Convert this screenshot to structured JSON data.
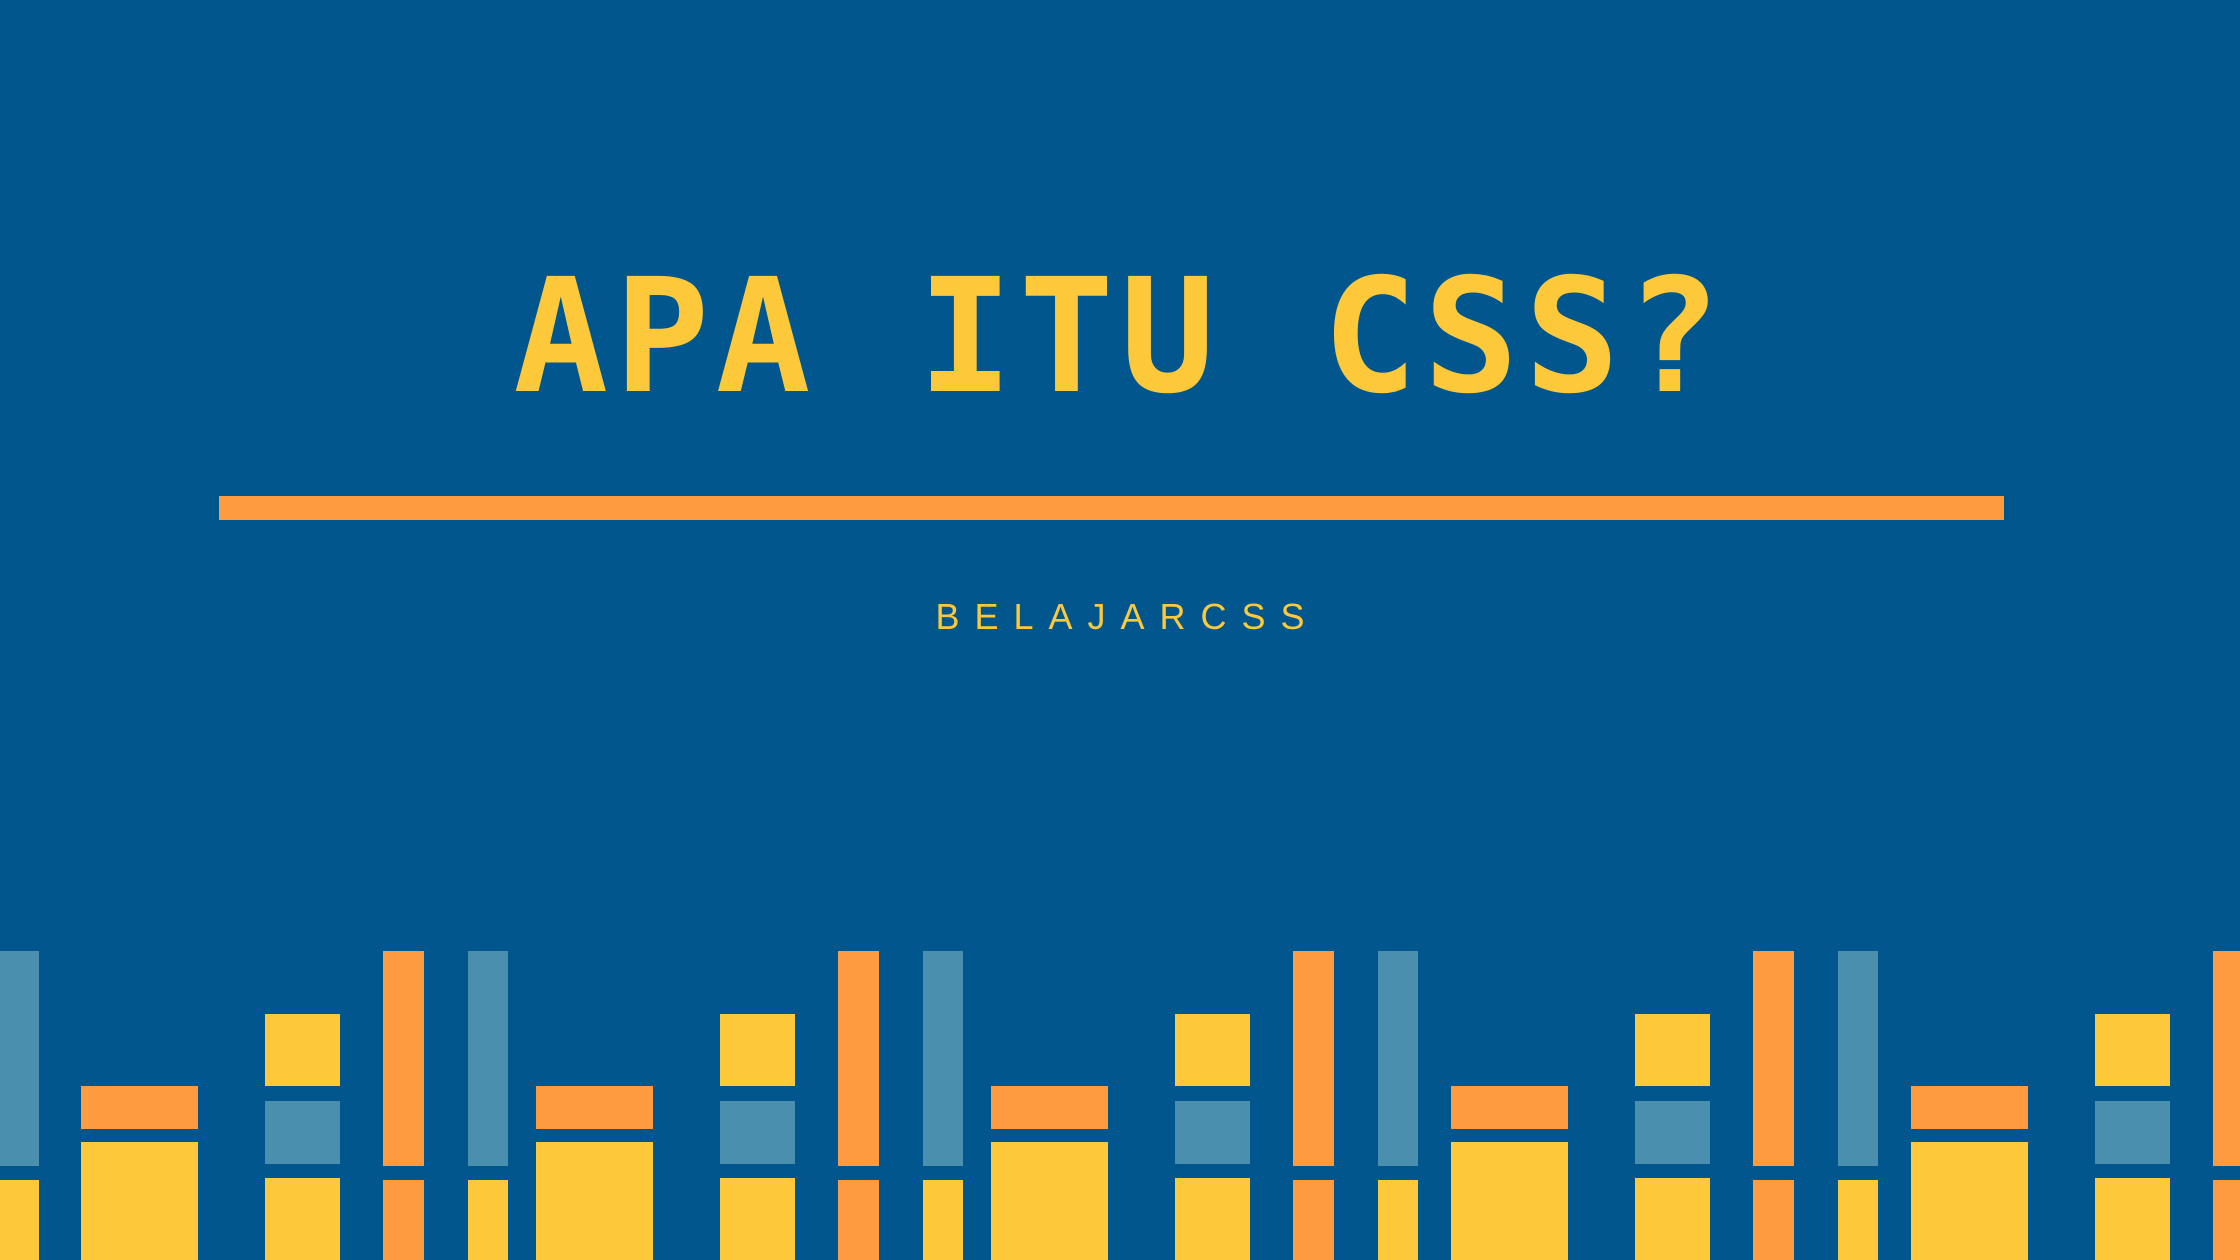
{
  "title": "APA ITU CSS?",
  "subtitle": "BELAJARCSS",
  "colors": {
    "background": "#00568d",
    "yellow": "#fdc93a",
    "orange": "#fe9a40",
    "teal": "#4a8fae"
  }
}
